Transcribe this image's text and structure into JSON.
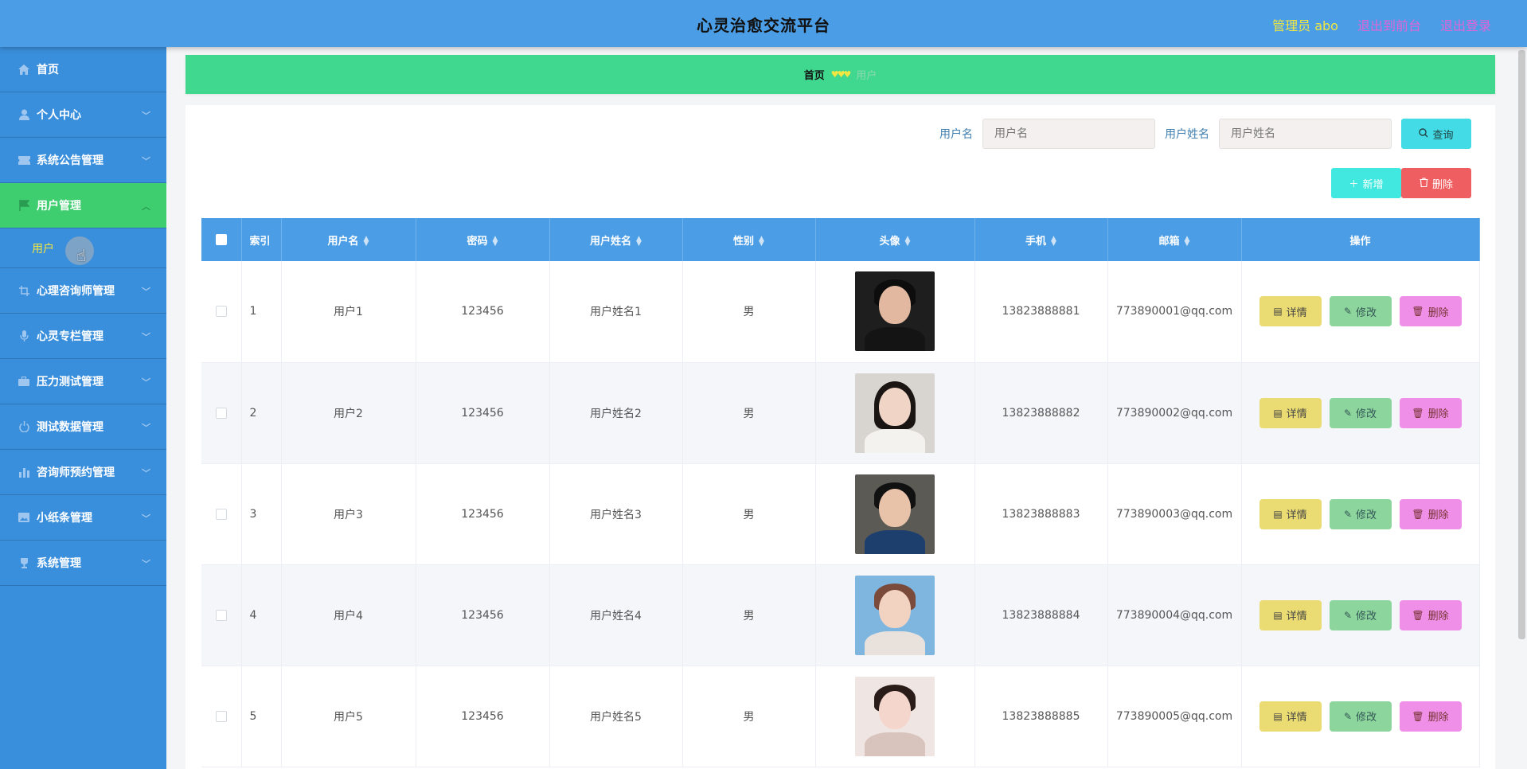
{
  "header": {
    "title": "心灵治愈交流平台",
    "admin": "管理员 abo",
    "front_link": "退出到前台",
    "logout_link": "退出登录"
  },
  "sidebar": {
    "items": [
      {
        "label": "首页",
        "icon": "home-icon"
      },
      {
        "label": "个人中心",
        "icon": "user-icon"
      },
      {
        "label": "系统公告管理",
        "icon": "ticket-icon"
      },
      {
        "label": "用户管理",
        "icon": "flag-icon"
      },
      {
        "label": "心理咨询师管理",
        "icon": "crop-icon"
      },
      {
        "label": "心灵专栏管理",
        "icon": "microphone-icon"
      },
      {
        "label": "压力测试管理",
        "icon": "briefcase-icon"
      },
      {
        "label": "测试数据管理",
        "icon": "power-icon"
      },
      {
        "label": "咨询师预约管理",
        "icon": "bar-chart-icon"
      },
      {
        "label": "小纸条管理",
        "icon": "picture-icon"
      },
      {
        "label": "系统管理",
        "icon": "trophy-icon"
      }
    ],
    "sub_item": "用户"
  },
  "breadcrumb": {
    "home": "首页",
    "separator": "♥♥♥",
    "current": "用户"
  },
  "search": {
    "username_label": "用户名",
    "username_placeholder": "用户名",
    "name_label": "用户姓名",
    "name_placeholder": "用户姓名",
    "query_label": "查询"
  },
  "toolbar": {
    "add_label": "新增",
    "delete_label": "删除"
  },
  "table": {
    "columns": [
      "索引",
      "用户名",
      "密码",
      "用户姓名",
      "性别",
      "头像",
      "手机",
      "邮箱",
      "操作"
    ],
    "rows": [
      {
        "index": "1",
        "username": "用户1",
        "password": "123456",
        "name": "用户姓名1",
        "gender": "男",
        "phone": "13823888881",
        "email": "773890001@qq.com"
      },
      {
        "index": "2",
        "username": "用户2",
        "password": "123456",
        "name": "用户姓名2",
        "gender": "男",
        "phone": "13823888882",
        "email": "773890002@qq.com"
      },
      {
        "index": "3",
        "username": "用户3",
        "password": "123456",
        "name": "用户姓名3",
        "gender": "男",
        "phone": "13823888883",
        "email": "773890003@qq.com"
      },
      {
        "index": "4",
        "username": "用户4",
        "password": "123456",
        "name": "用户姓名4",
        "gender": "男",
        "phone": "13823888884",
        "email": "773890004@qq.com"
      },
      {
        "index": "5",
        "username": "用户5",
        "password": "123456",
        "name": "用户姓名5",
        "gender": "男",
        "phone": "13823888885",
        "email": "773890005@qq.com"
      }
    ],
    "row_actions": {
      "detail": "详情",
      "edit": "修改",
      "remove": "删除"
    }
  },
  "colors": {
    "header_bg": "#4b9ee6",
    "sidebar_bg": "#3a8fdc",
    "active_menu": "#3fce6f",
    "breadcrumb_bg": "#40d88f",
    "accent_yellow": "#f2e640",
    "link_pink": "#e264d8"
  }
}
